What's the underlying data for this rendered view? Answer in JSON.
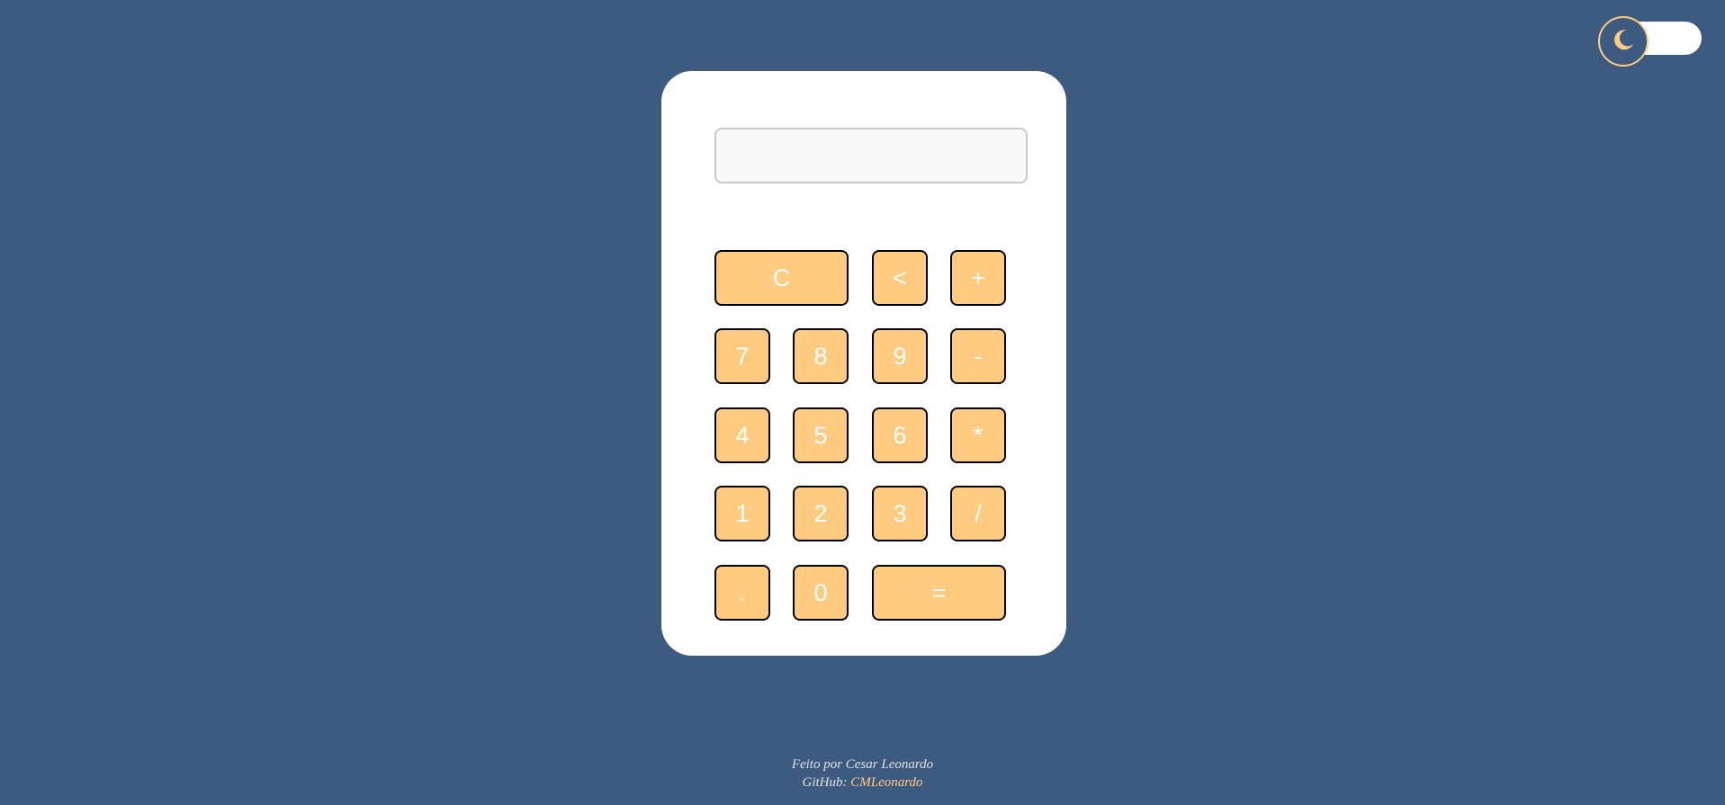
{
  "theme_toggle": {
    "icon": "moon-icon",
    "mode": "dark"
  },
  "calculator": {
    "display": {
      "value": "",
      "placeholder": ""
    },
    "keys": [
      {
        "label": "C",
        "name": "clear-button"
      },
      {
        "label": "<",
        "name": "backspace-button"
      },
      {
        "label": "+",
        "name": "add-button"
      },
      {
        "label": "7",
        "name": "digit-7-button"
      },
      {
        "label": "8",
        "name": "digit-8-button"
      },
      {
        "label": "9",
        "name": "digit-9-button"
      },
      {
        "label": "-",
        "name": "subtract-button"
      },
      {
        "label": "4",
        "name": "digit-4-button"
      },
      {
        "label": "5",
        "name": "digit-5-button"
      },
      {
        "label": "6",
        "name": "digit-6-button"
      },
      {
        "label": "*",
        "name": "multiply-button"
      },
      {
        "label": "1",
        "name": "digit-1-button"
      },
      {
        "label": "2",
        "name": "digit-2-button"
      },
      {
        "label": "3",
        "name": "digit-3-button"
      },
      {
        "label": "/",
        "name": "divide-button"
      },
      {
        "label": ".",
        "name": "decimal-button"
      },
      {
        "label": "0",
        "name": "digit-0-button"
      },
      {
        "label": "=",
        "name": "equals-button"
      }
    ]
  },
  "footer": {
    "credit": "Feito por Cesar Leonardo",
    "github_label": "GitHub:",
    "github_link": "CMLeonardo"
  },
  "colors": {
    "background": "#3d5a80",
    "card": "#ffffff",
    "key_fill": "#ffcb80",
    "key_border": "#000000",
    "key_text": "#ffffff",
    "link": "#ffcb80"
  }
}
